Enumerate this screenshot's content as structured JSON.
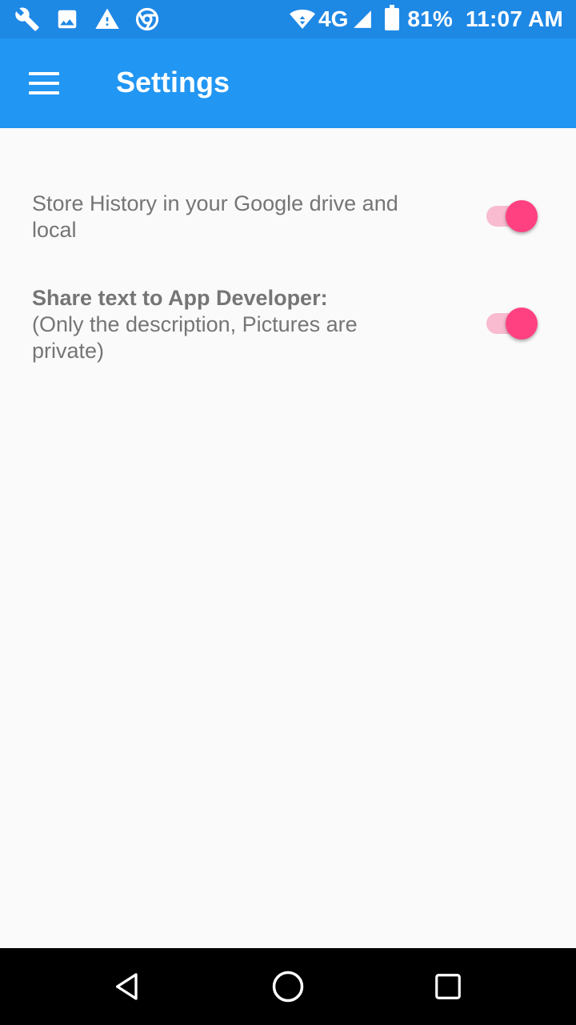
{
  "status_bar": {
    "battery_percent": "81%",
    "time": "11:07 AM",
    "network_type": "4G",
    "left_icons": [
      "wrench-icon",
      "image-icon",
      "warning-icon",
      "chrome-icon"
    ],
    "right_icons": [
      "wifi-icon",
      "signal-icon",
      "battery-icon"
    ]
  },
  "app_bar": {
    "title": "Settings",
    "color": "#2196F3",
    "menu_icon": "hamburger-menu-icon"
  },
  "settings": [
    {
      "label": "Store History in your Google drive and local",
      "enabled": true
    },
    {
      "label_bold": "Share text to App Developer:",
      "label": "(Only the description, Pictures are private)",
      "enabled": true
    }
  ],
  "accent_color": "#FF4081",
  "nav_bar": {
    "buttons": [
      "back-icon",
      "home-icon",
      "recents-icon"
    ]
  }
}
